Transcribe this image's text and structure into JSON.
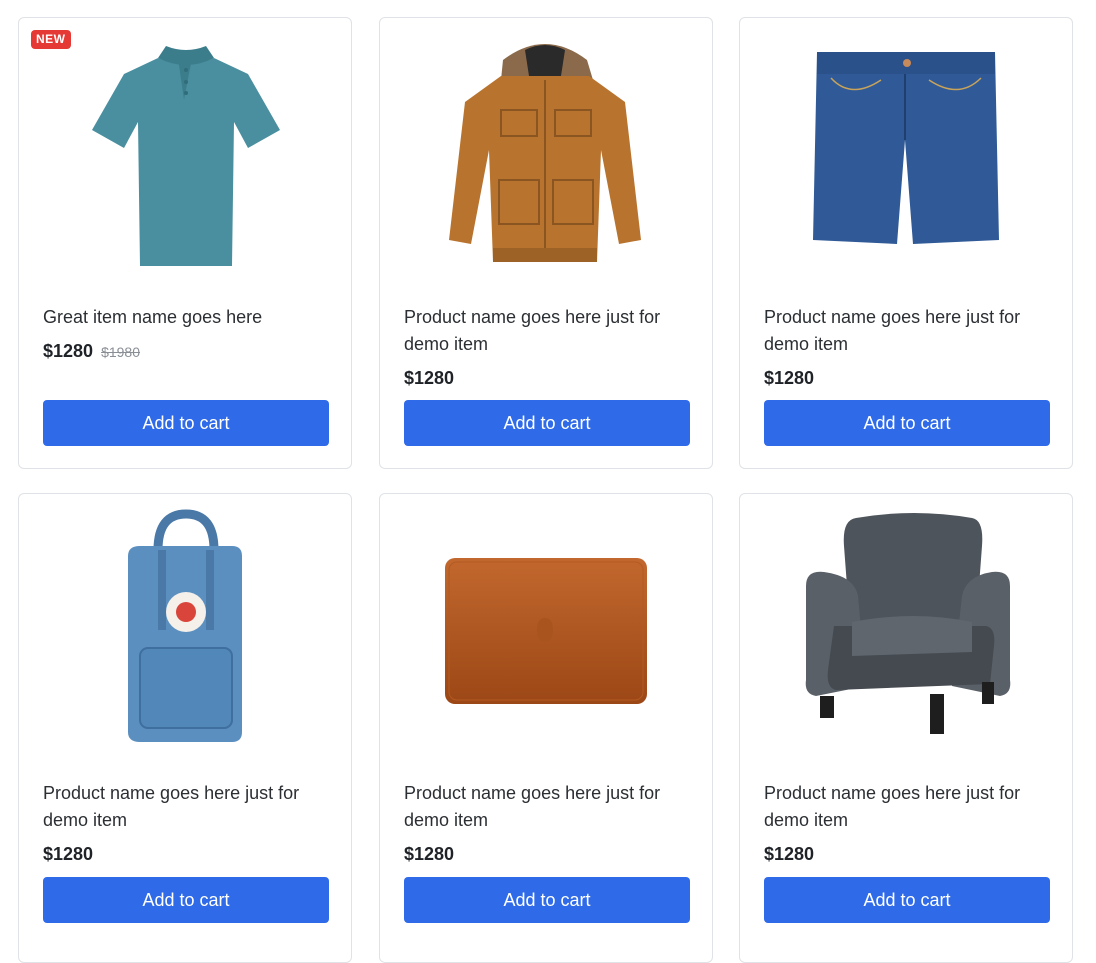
{
  "products": [
    {
      "title": "Great item name goes here",
      "price": "$1280",
      "old_price": "$1980",
      "badge": "NEW",
      "button": "Add to cart"
    },
    {
      "title": "Product name goes here just for demo item",
      "price": "$1280",
      "button": "Add to cart"
    },
    {
      "title": "Product name goes here just for demo item",
      "price": "$1280",
      "button": "Add to cart"
    },
    {
      "title": "Product name goes here just for demo item",
      "price": "$1280",
      "button": "Add to cart"
    },
    {
      "title": "Product name goes here just for demo item",
      "price": "$1280",
      "button": "Add to cart"
    },
    {
      "title": "Product name goes here just for demo item",
      "price": "$1280",
      "button": "Add to cart"
    }
  ],
  "images": [
    "polo-shirt-image",
    "brown-jacket-image",
    "denim-shorts-image",
    "backpack-image",
    "leather-sleeve-image",
    "armchair-image"
  ],
  "colors": {
    "accent": "#2f6ae9",
    "badge": "#e53935",
    "border": "#dfe2e6"
  }
}
